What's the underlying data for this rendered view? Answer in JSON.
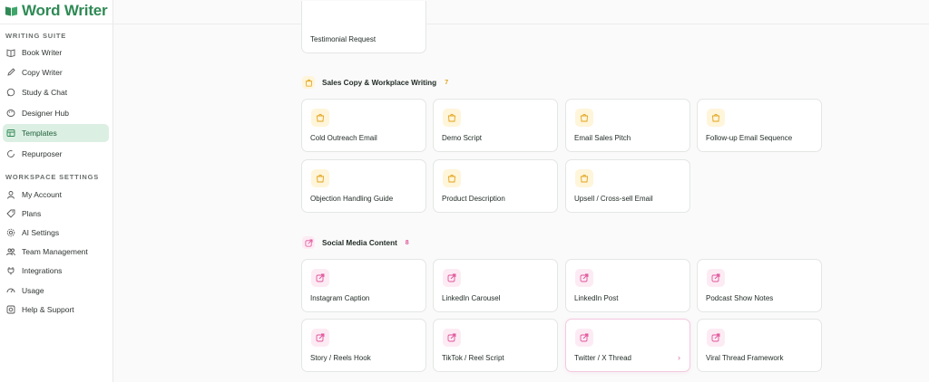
{
  "app": {
    "name": "Word Writer",
    "brand_color": "#2f8a55"
  },
  "sidebar": {
    "writing_suite_label": "WRITING SUITE",
    "workspace_label": "WORKSPACE SETTINGS",
    "writing_items": [
      {
        "label": "Book Writer",
        "icon": "book-icon"
      },
      {
        "label": "Copy Writer",
        "icon": "pen-icon"
      },
      {
        "label": "Study & Chat",
        "icon": "chat-icon"
      },
      {
        "label": "Designer Hub",
        "icon": "palette-icon"
      },
      {
        "label": "Templates",
        "icon": "template-icon",
        "active": true
      },
      {
        "label": "Repurposer",
        "icon": "refresh-icon"
      }
    ],
    "workspace_items": [
      {
        "label": "My Account",
        "icon": "user-icon"
      },
      {
        "label": "Plans",
        "icon": "tag-icon"
      },
      {
        "label": "AI Settings",
        "icon": "gear-icon"
      },
      {
        "label": "Team Management",
        "icon": "team-icon"
      },
      {
        "label": "Integrations",
        "icon": "plug-icon"
      },
      {
        "label": "Usage",
        "icon": "gauge-icon"
      },
      {
        "label": "Help & Support",
        "icon": "help-icon"
      }
    ]
  },
  "partial_card": {
    "title": "Testimonial Request"
  },
  "sections": [
    {
      "title": "Sales Copy & Workplace Writing",
      "count": "7",
      "color": "#e0a21a",
      "cards": [
        "Cold Outreach Email",
        "Demo Script",
        "Email Sales Pitch",
        "Follow-up Email Sequence",
        "Objection Handling Guide",
        "Product Description",
        "Upsell / Cross-sell Email"
      ]
    },
    {
      "title": "Social Media Content",
      "count": "8",
      "color": "#e0559a",
      "cards": [
        "Instagram Caption",
        "LinkedIn Carousel",
        "LinkedIn Post",
        "Podcast Show Notes",
        "Story / Reels Hook",
        "TikTok / Reel Script",
        "Twitter / X Thread",
        "Viral Thread Framework"
      ]
    }
  ],
  "hovered_card_arrow": "›"
}
